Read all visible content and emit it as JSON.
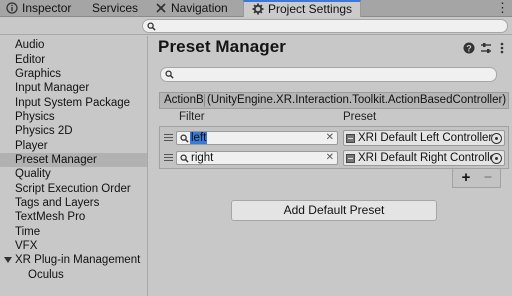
{
  "tabs": [
    {
      "label": "Inspector",
      "icon": "info-icon",
      "active": false
    },
    {
      "label": "Services",
      "icon": "cloud-icon",
      "active": false
    },
    {
      "label": "Navigation",
      "icon": "navigation-icon",
      "active": false
    },
    {
      "label": "Project Settings",
      "icon": "gear-icon",
      "active": true
    }
  ],
  "tab_menu_icon": "more-vertical-icon",
  "top_search": {
    "value": "",
    "placeholder": "",
    "icon": "search-icon"
  },
  "sidebar": {
    "items": [
      {
        "label": "Audio"
      },
      {
        "label": "Editor"
      },
      {
        "label": "Graphics"
      },
      {
        "label": "Input Manager"
      },
      {
        "label": "Input System Package"
      },
      {
        "label": "Physics"
      },
      {
        "label": "Physics 2D"
      },
      {
        "label": "Player"
      },
      {
        "label": "Preset Manager",
        "selected": true
      },
      {
        "label": "Quality"
      },
      {
        "label": "Script Execution Order"
      },
      {
        "label": "Tags and Layers"
      },
      {
        "label": "TextMesh Pro"
      },
      {
        "label": "Time"
      },
      {
        "label": "VFX"
      },
      {
        "label": "XR Plug-in Management",
        "expanded": true
      },
      {
        "label": "Oculus",
        "child": true
      }
    ]
  },
  "main": {
    "title": "Preset Manager",
    "header_icons": [
      "help-icon",
      "preset-icon",
      "settings-menu-icon"
    ],
    "search": {
      "value": "",
      "icon": "search-icon"
    },
    "type_row": {
      "short_name": "ActionB",
      "full_type": "(UnityEngine.XR.Interaction.Toolkit.ActionBasedController)"
    },
    "columns": {
      "filter": "Filter",
      "preset": "Preset"
    },
    "rows": [
      {
        "filter": "left",
        "filter_selected": true,
        "preset": "XRI Default Left Controller"
      },
      {
        "filter": "right",
        "filter_selected": false,
        "preset": "XRI Default Right Controller"
      }
    ],
    "add_label": "+",
    "remove_label": "−",
    "add_default_preset": "Add Default Preset"
  },
  "colors": {
    "accent": "#3a79d7",
    "background": "#c8c8c8",
    "tab_bar": "#a5a5a5"
  }
}
